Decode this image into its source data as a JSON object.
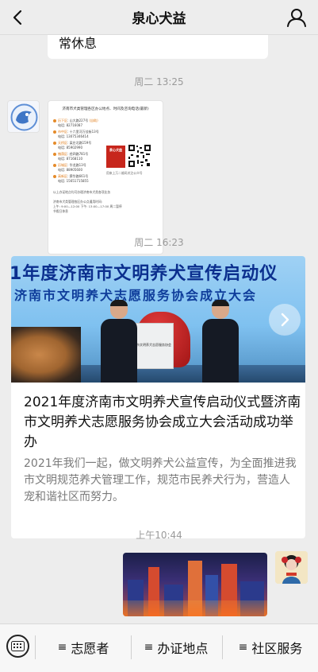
{
  "header": {
    "title": "泉心犬益"
  },
  "messages": {
    "top_bubble_text": "常休息",
    "timestamp1": "周二 13:25",
    "timestamp2": "周二 16:23",
    "timestamp3": "上午10:44"
  },
  "poster": {
    "title": "济南市犬类管理各区办公地点、时间及咨询电话(最新)",
    "rows": [
      {
        "district": "历下区",
        "addr": "山大路227号",
        "tag": "(自助)",
        "tel_label": "电话",
        "tel": "82716087"
      },
      {
        "district": "市中区",
        "addr": "十六里河万佳街13号",
        "tag": "",
        "tel_label": "电话",
        "tel": "13075346414"
      },
      {
        "district": "天桥区",
        "addr": "梁庄北路159号",
        "tag": "",
        "tel_label": "电话",
        "tel": "85902990"
      },
      {
        "district": "槐荫区",
        "addr": "经四路781号",
        "tag": "",
        "tel_label": "电话",
        "tel": "87168110"
      },
      {
        "district": "历城区",
        "addr": "华龙路13号",
        "tag": "",
        "tel_label": "电话",
        "tel": "88905600"
      },
      {
        "district": "高新区",
        "addr": "舜华路661号",
        "tag": "",
        "tel_label": "电话",
        "tel": "15651715855"
      }
    ],
    "note": "以上办证地点均可办理济南市犬类各项业务",
    "foot1": "济南市犬类管理各区办公点通用时间:",
    "foot2": "上午: 9:00—12:00  下午: 13:00—17:00  周二暂停",
    "foot3": "节假日休息",
    "logo_text": "泉心犬益",
    "qr_caption": "用来上万二维码关注公众号"
  },
  "card": {
    "banner_line1": "1年度济南市文明养犬宣传启动仪",
    "banner_line2": "济南市文明养犬志愿服务协会成立大会",
    "plaque_text": "济南市文明养犬志愿服务协会",
    "title": "2021年度济南市文明养犬宣传启动仪式暨济南市文明养犬志愿服务协会成立大会活动成功举办",
    "desc": "2021年我们一起，做文明养犬公益宣传，为全面推进我市文明规范养犬管理工作，规范市民养犬行为，营造人宠和谐社区而努力。"
  },
  "bottom_menu": {
    "items": [
      {
        "label": "志愿者"
      },
      {
        "label": "办证地点"
      },
      {
        "label": "社区服务"
      }
    ]
  }
}
